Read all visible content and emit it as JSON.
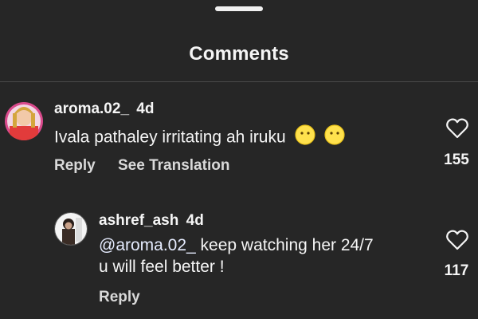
{
  "header": {
    "title": "Comments"
  },
  "comments": [
    {
      "username": "aroma.02_",
      "age": "4d",
      "text": "Ivala pathaley irritating ah iruku",
      "emojis": [
        "😶",
        "😶"
      ],
      "reply_label": "Reply",
      "translate_label": "See Translation",
      "likes": "155"
    }
  ],
  "replies": [
    {
      "username": "ashref_ash",
      "age": "4d",
      "mention": "@aroma.02_",
      "text_line1": " keep watching her 24/7",
      "text_line2": "u will feel better !",
      "reply_label": "Reply",
      "likes": "117"
    }
  ],
  "colors": {
    "background": "#262626",
    "text": "#f5f5f5",
    "divider": "#4a4a4a"
  }
}
